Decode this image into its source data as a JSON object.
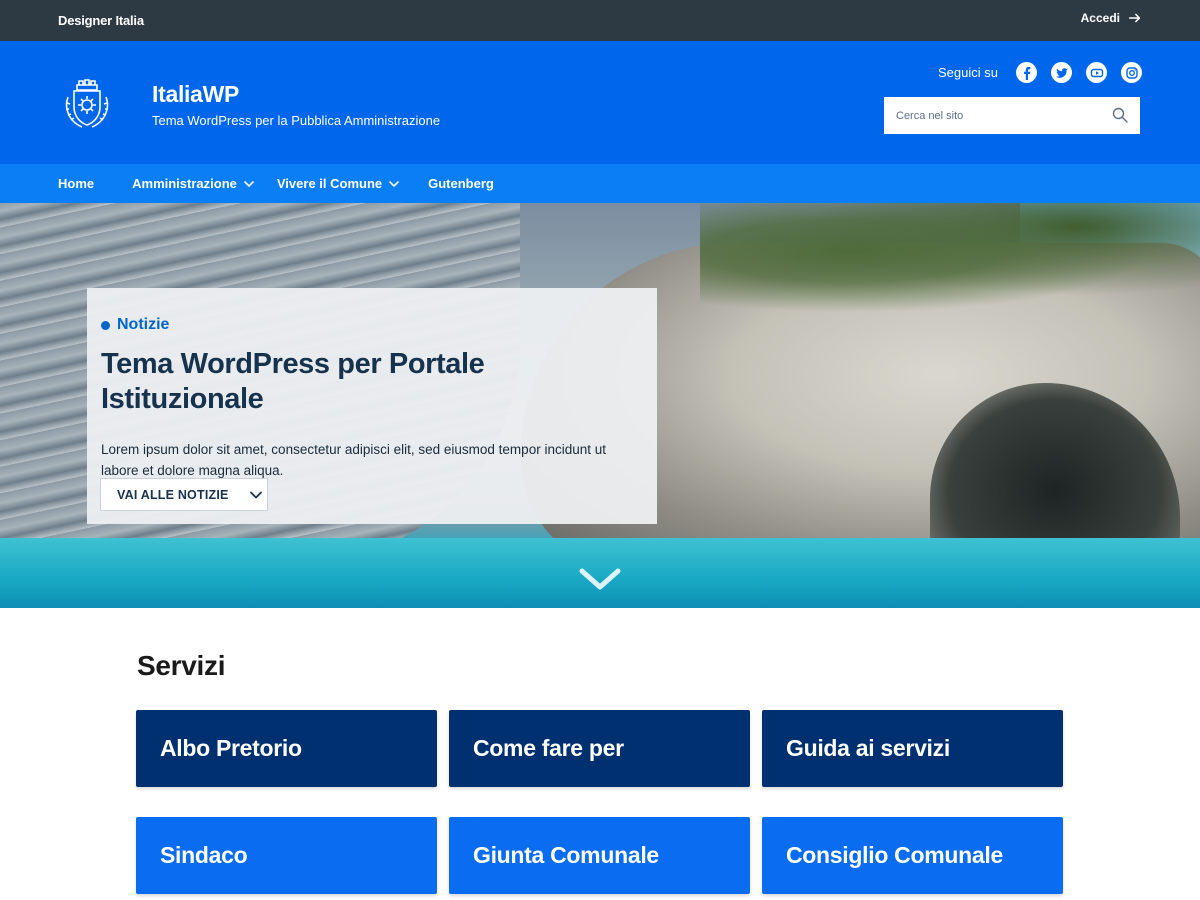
{
  "topbar": {
    "brand": "Designer Italia",
    "login_label": "Accedi"
  },
  "header": {
    "site_title": "ItaliaWP",
    "tagline": "Tema WordPress per la Pubblica Amministrazione",
    "follow_label": "Seguici su",
    "social_icons": [
      "facebook-icon",
      "twitter-icon",
      "youtube-icon",
      "instagram-icon"
    ],
    "search_placeholder": "Cerca nel sito"
  },
  "nav": {
    "items": [
      {
        "label": "Home",
        "has_dropdown": false
      },
      {
        "label": "Amministrazione",
        "has_dropdown": true
      },
      {
        "label": "Vivere il Comune",
        "has_dropdown": true
      },
      {
        "label": "Gutenberg",
        "has_dropdown": false
      }
    ]
  },
  "hero": {
    "category": "Notizie",
    "title": "Tema WordPress per Portale Istituzionale",
    "text": "Lorem ipsum dolor sit amet, consectetur adipisci elit, sed eiusmod tempor incidunt ut labore et dolore magna aliqua.",
    "button_label": "VAI ALLE NOTIZIE"
  },
  "services": {
    "title": "Servizi",
    "cards": [
      {
        "label": "Albo Pretorio",
        "style": "dark"
      },
      {
        "label": "Come fare per",
        "style": "dark"
      },
      {
        "label": "Guida ai servizi",
        "style": "dark"
      },
      {
        "label": "Sindaco",
        "style": "blue"
      },
      {
        "label": "Giunta Comunale",
        "style": "blue"
      },
      {
        "label": "Consiglio Comunale",
        "style": "blue"
      }
    ]
  },
  "colors": {
    "topbar_bg": "#2e3a43",
    "header_bg": "#0066ec",
    "nav_bg": "#0a7ff5",
    "card_dark": "#003070",
    "card_blue": "#0a6cf0",
    "hero_title": "#17324d",
    "accent": "#0066cc"
  }
}
